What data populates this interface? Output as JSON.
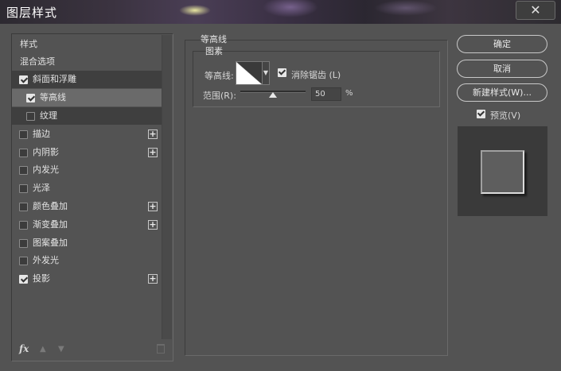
{
  "window": {
    "title": "图层样式",
    "close_label": "✕"
  },
  "sidebar": {
    "items": [
      {
        "label": "样式",
        "checkbox": null,
        "plus": false
      },
      {
        "label": "混合选项",
        "checkbox": null,
        "plus": false
      },
      {
        "label": "斜面和浮雕",
        "checkbox": true,
        "plus": false
      },
      {
        "label": "等高线",
        "checkbox": true,
        "plus": false,
        "selected": true
      },
      {
        "label": "纹理",
        "checkbox": false,
        "plus": false
      },
      {
        "label": "描边",
        "checkbox": false,
        "plus": true
      },
      {
        "label": "内阴影",
        "checkbox": false,
        "plus": true
      },
      {
        "label": "内发光",
        "checkbox": false,
        "plus": false
      },
      {
        "label": "光泽",
        "checkbox": false,
        "plus": false
      },
      {
        "label": "颜色叠加",
        "checkbox": false,
        "plus": true
      },
      {
        "label": "渐变叠加",
        "checkbox": false,
        "plus": true
      },
      {
        "label": "图案叠加",
        "checkbox": false,
        "plus": false
      },
      {
        "label": "外发光",
        "checkbox": false,
        "plus": false
      },
      {
        "label": "投影",
        "checkbox": true,
        "plus": true
      }
    ],
    "footer": {
      "fx": "fx",
      "up": "▲",
      "down": "▼"
    }
  },
  "contour_panel": {
    "group_title": "等高线",
    "sub_title": "图素",
    "contour_label": "等高线:",
    "antialias_label": "消除锯齿 (L)",
    "antialias_checked": true,
    "range_label": "范围(R):",
    "range_value": "50",
    "range_unit": "%",
    "range_fraction": 0.5
  },
  "actions": {
    "ok": "确定",
    "cancel": "取消",
    "new_style": "新建样式(W)...",
    "preview_label": "预览(V)",
    "preview_checked": true
  },
  "colors": {
    "panel_bg": "#535353",
    "selected_row": "#6a6a6a",
    "dark_row": "#3f3f3f"
  }
}
